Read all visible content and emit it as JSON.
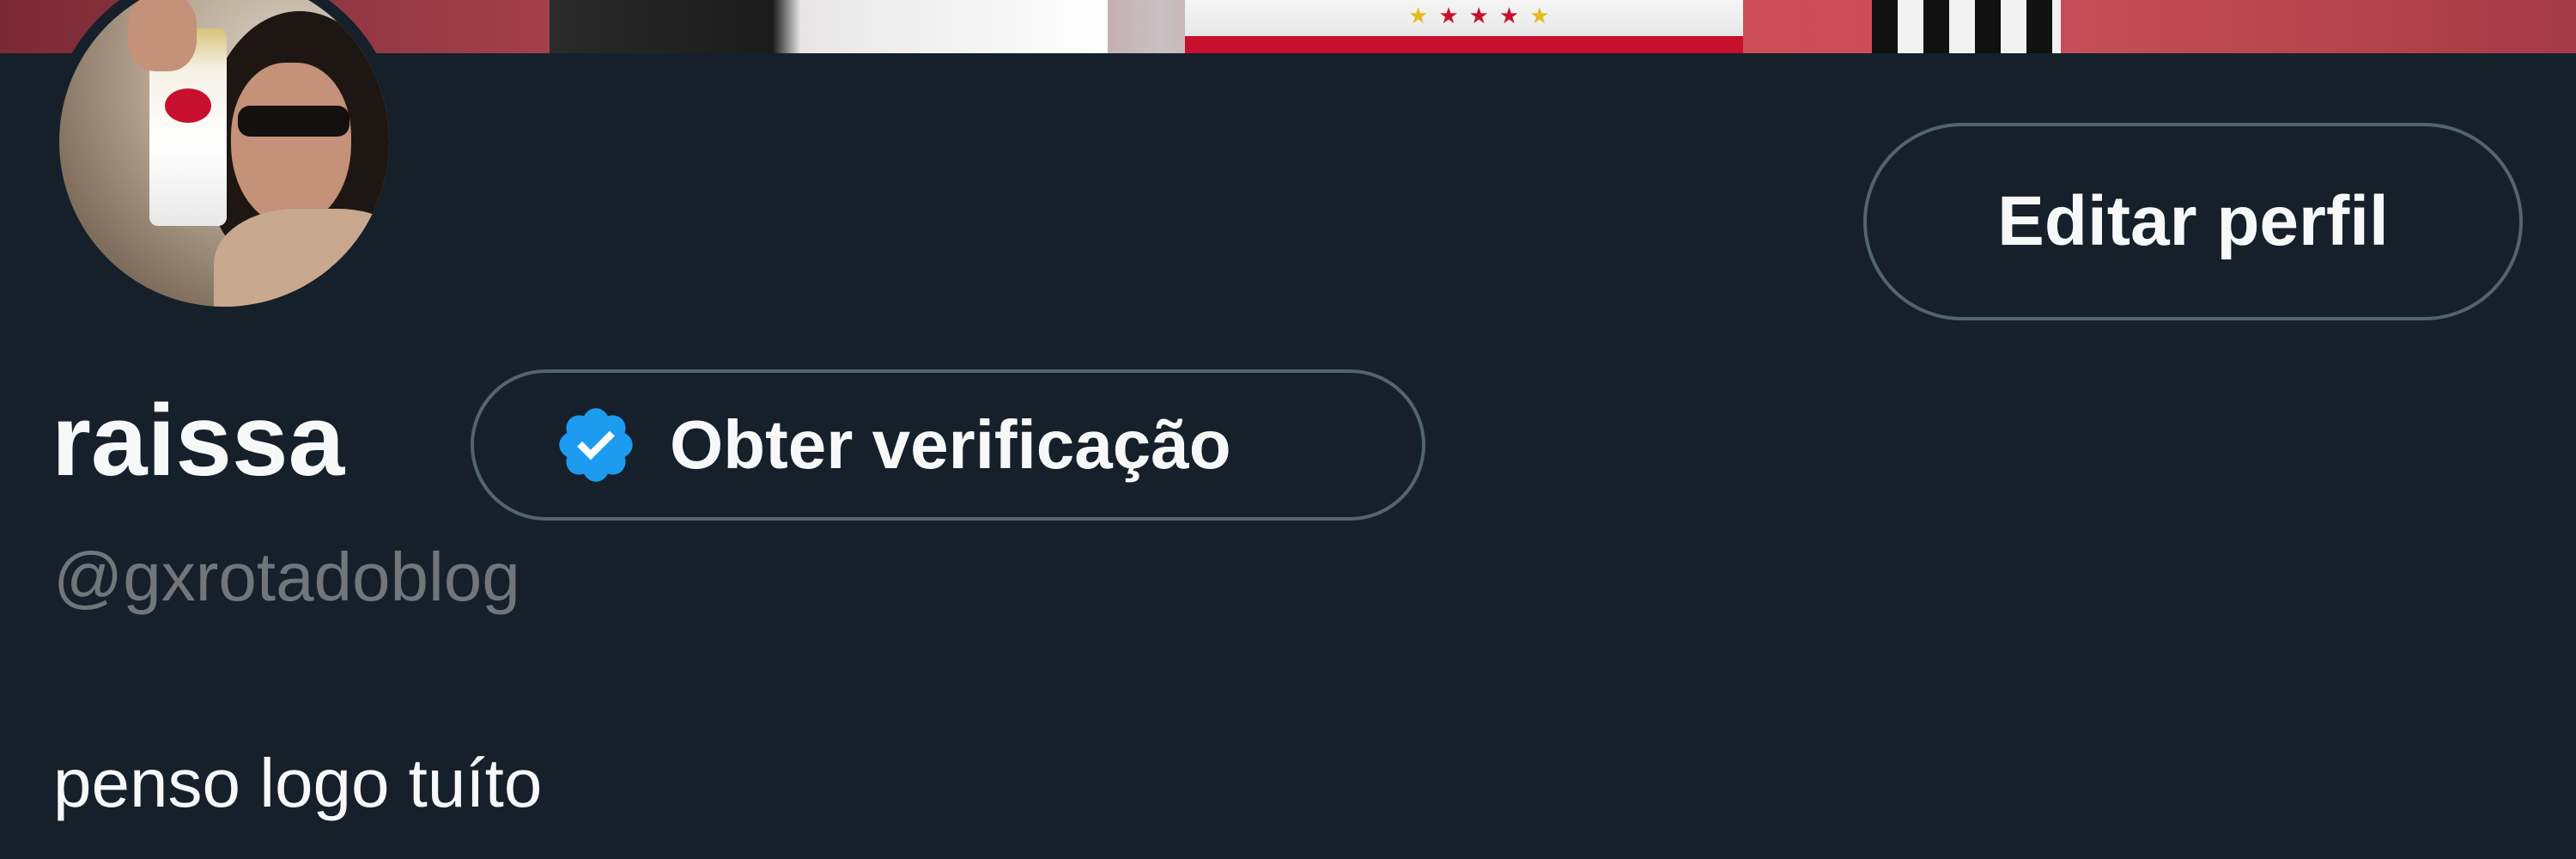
{
  "profile": {
    "display_name": "raissa",
    "handle": "@gxrotadoblog",
    "bio": "penso logo tuíto"
  },
  "actions": {
    "edit_profile_label": "Editar perfil",
    "get_verified_label": "Obter verificação"
  },
  "icons": {
    "verified_badge": "verified-badge-icon"
  },
  "colors": {
    "background": "#15202b",
    "primary_text": "#f7f9f9",
    "secondary_text": "#71767b",
    "button_border": "#536471",
    "verified_blue": "#1d9bf0"
  }
}
